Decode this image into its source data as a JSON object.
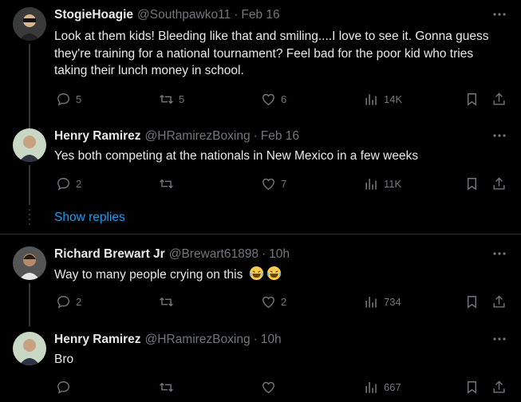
{
  "tweets": [
    {
      "name": "StogieHoagie",
      "handle": "@Southpawko11",
      "dot": "·",
      "time": "Feb 16",
      "text": "Look at them kids! Bleeding like that and smiling....I love to see it. Gonna guess they're training for a national tournament? Feel bad for the poor kid who tries taking their lunch money in school.",
      "replies": "5",
      "retweets": "5",
      "likes": "6",
      "views": "14K"
    },
    {
      "name": "Henry Ramirez",
      "handle": "@HRamirezBoxing",
      "dot": "·",
      "time": "Feb 16",
      "text": "Yes both competing at the nationals in New Mexico in a few weeks",
      "replies": "2",
      "retweets": "",
      "likes": "7",
      "views": "11K"
    },
    {
      "name": "Richard Brewart Jr",
      "handle": "@Brewart61898",
      "dot": "·",
      "time": "10h",
      "text": "Way to many people crying on this",
      "emoji": "😂😂",
      "replies": "2",
      "retweets": "",
      "likes": "2",
      "views": "734"
    },
    {
      "name": "Henry Ramirez",
      "handle": "@HRamirezBoxing",
      "dot": "·",
      "time": "10h",
      "text": "Bro",
      "replies": "",
      "retweets": "",
      "likes": "",
      "views": "667"
    }
  ],
  "show_replies": "Show replies",
  "icons": {
    "reply": "reply-icon",
    "retweet": "retweet-icon",
    "like": "heart-icon",
    "views": "views-icon",
    "bookmark": "bookmark-icon",
    "share": "share-icon",
    "more": "more-icon"
  },
  "colors": {
    "background": "#000000",
    "text": "#e7e9ea",
    "muted": "#71767b",
    "link": "#1d9bf0",
    "divider": "#2f3336"
  }
}
